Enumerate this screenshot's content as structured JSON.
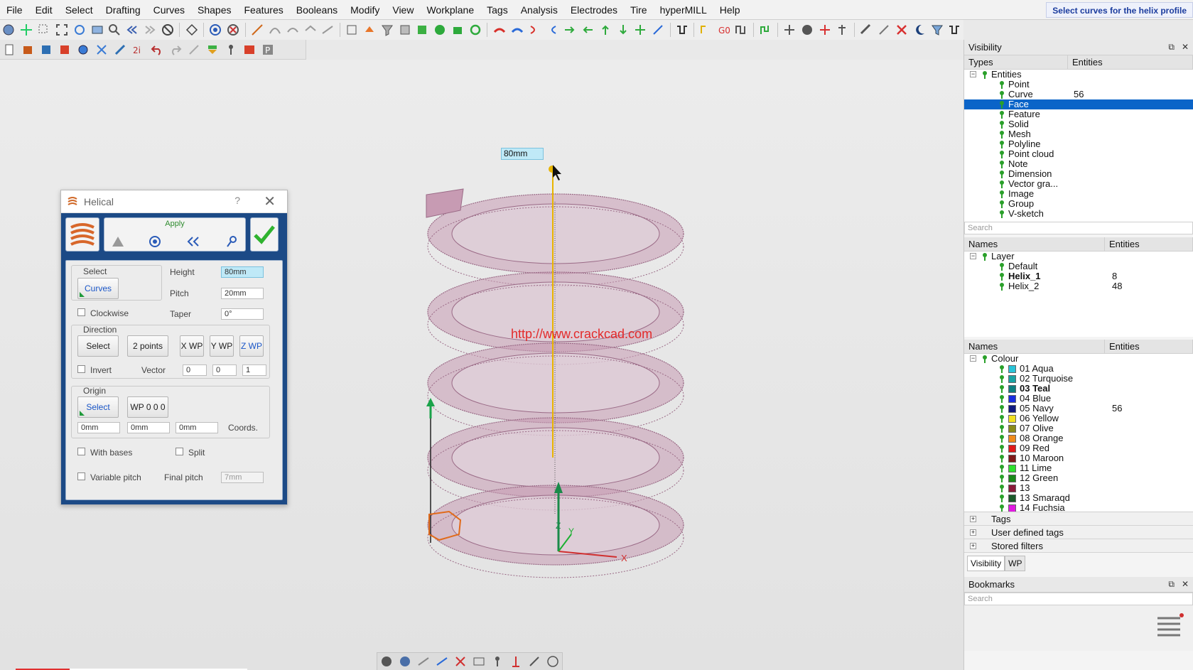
{
  "menu": [
    "File",
    "Edit",
    "Select",
    "Drafting",
    "Curves",
    "Shapes",
    "Features",
    "Booleans",
    "Modify",
    "View",
    "Workplane",
    "Tags",
    "Analysis",
    "Electrodes",
    "Tire",
    "hyperMILL",
    "Help"
  ],
  "status_hint": "Select curves for the helix profile",
  "viewport": {
    "dimension_value": "80mm",
    "watermark": "http://www.crackcad.com",
    "axis_labels": {
      "x": "X",
      "y": "Y",
      "z": "Z"
    }
  },
  "dialog": {
    "title": "Helical",
    "help": "?",
    "close": "✕",
    "apply_label": "Apply",
    "select_group": "Select",
    "curves_button": "Curves",
    "clockwise_label": "Clockwise",
    "height_label": "Height",
    "height_value": "80mm",
    "pitch_label": "Pitch",
    "pitch_value": "20mm",
    "taper_label": "Taper",
    "taper_value": "0°",
    "direction_group": "Direction",
    "direction_select": "Select",
    "two_points": "2 points",
    "x_wp": "X WP",
    "y_wp": "Y WP",
    "z_wp": "Z WP",
    "invert_label": "Invert",
    "vector_label": "Vector",
    "vector": [
      "0",
      "0",
      "1"
    ],
    "origin_group": "Origin",
    "origin_select": "Select",
    "wp_000": "WP 0 0 0",
    "coords": [
      "0mm",
      "0mm",
      "0mm"
    ],
    "coords_label": "Coords.",
    "with_bases_label": "With bases",
    "split_label": "Split",
    "variable_pitch_label": "Variable pitch",
    "final_pitch_label": "Final pitch",
    "final_pitch_value": "7mm"
  },
  "visibility": {
    "title": "Visibility",
    "col_types": "Types",
    "col_entities": "Entities",
    "root": "Entities",
    "types": [
      {
        "label": "Point",
        "count": ""
      },
      {
        "label": "Curve",
        "count": "56"
      },
      {
        "label": "Face",
        "count": ""
      },
      {
        "label": "Feature",
        "count": ""
      },
      {
        "label": "Solid",
        "count": ""
      },
      {
        "label": "Mesh",
        "count": ""
      },
      {
        "label": "Polyline",
        "count": ""
      },
      {
        "label": "Point cloud",
        "count": ""
      },
      {
        "label": "Note",
        "count": ""
      },
      {
        "label": "Dimension",
        "count": ""
      },
      {
        "label": "Vector gra...",
        "count": ""
      },
      {
        "label": "Image",
        "count": ""
      },
      {
        "label": "Group",
        "count": ""
      },
      {
        "label": "V-sketch",
        "count": ""
      }
    ],
    "search_placeholder": "Search"
  },
  "layers": {
    "col_names": "Names",
    "col_entities": "Entities",
    "root": "Layer",
    "items": [
      {
        "label": "Default",
        "count": ""
      },
      {
        "label": "Helix_1",
        "count": "8"
      },
      {
        "label": "Helix_2",
        "count": "48"
      }
    ]
  },
  "colours": {
    "col_names": "Names",
    "col_entities": "Entities",
    "root": "Colour",
    "items": [
      {
        "label": "01 Aqua",
        "count": "",
        "color": "#29c4d8"
      },
      {
        "label": "02 Turquoise",
        "count": "",
        "color": "#1aa3a3"
      },
      {
        "label": "03 Teal",
        "count": "",
        "color": "#0f7f80"
      },
      {
        "label": "04 Blue",
        "count": "",
        "color": "#1a2ee0"
      },
      {
        "label": "05 Navy",
        "count": "56",
        "color": "#101a80"
      },
      {
        "label": "06 Yellow",
        "count": "",
        "color": "#f2e021"
      },
      {
        "label": "07 Olive",
        "count": "",
        "color": "#8a8a1a"
      },
      {
        "label": "08 Orange",
        "count": "",
        "color": "#f08a1a"
      },
      {
        "label": "09 Red",
        "count": "",
        "color": "#e01a1a"
      },
      {
        "label": "10 Maroon",
        "count": "",
        "color": "#801a1a"
      },
      {
        "label": "11 Lime",
        "count": "",
        "color": "#2ee02e"
      },
      {
        "label": "12 Green",
        "count": "",
        "color": "#1a8a1a"
      },
      {
        "label": "13",
        "count": "",
        "color": "#8a1a3a"
      },
      {
        "label": "13 Smaraqd",
        "count": "",
        "color": "#1a5a2a"
      },
      {
        "label": "14 Fuchsia",
        "count": "",
        "color": "#e01ae0"
      }
    ]
  },
  "bottom_tree": [
    "Tags",
    "User defined tags",
    "Stored filters"
  ],
  "tabs": [
    "Visibility",
    "WP"
  ],
  "bookmarks": {
    "title": "Bookmarks",
    "search_placeholder": "Search"
  },
  "colors": {
    "helix_fill": "#c79bb3",
    "helix_stroke": "#9a6a86",
    "axis_line": "#e8b400",
    "accent": "#1c4a86"
  }
}
